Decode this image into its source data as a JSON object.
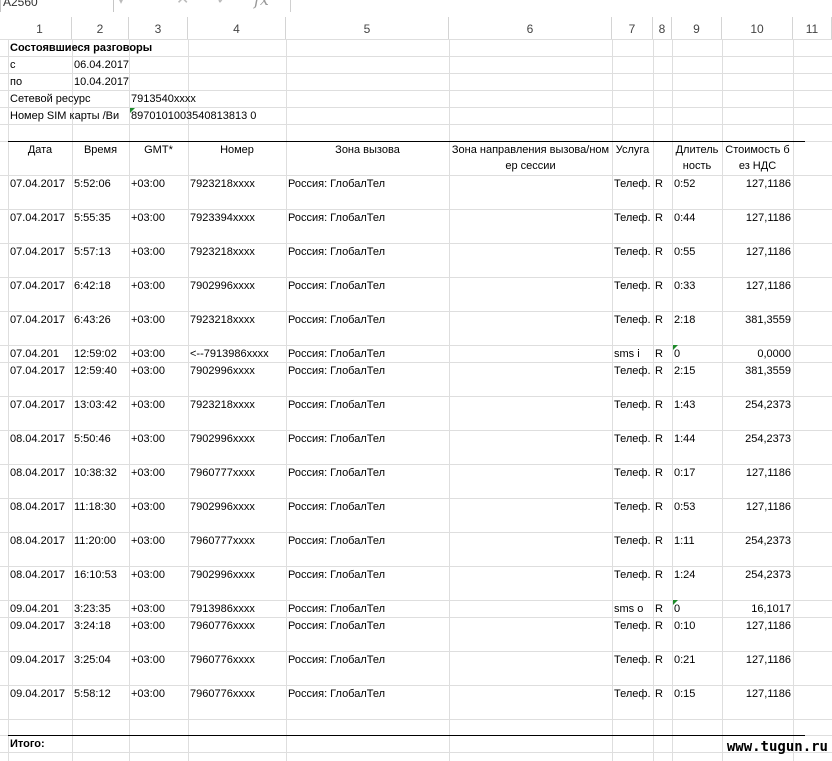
{
  "formula_bar": {
    "name_box": "A2560",
    "fx_symbol": "fx",
    "cancel_symbol": "✕",
    "confirm_symbol": "✓"
  },
  "column_headers": [
    "1",
    "2",
    "3",
    "4",
    "5",
    "6",
    "7",
    "8",
    "9",
    "10",
    "11"
  ],
  "header_block": {
    "title": "Состоявшиеся разговоры",
    "from_label": "с",
    "from_value": "06.04.2017",
    "to_label": "по",
    "to_value": "10.04.2017",
    "resource_label": "Сетевой ресурс",
    "resource_value": "7913540xxxx",
    "sim_label": "Номер SIM карты /Ви",
    "sim_value": "8970101003540813813 0"
  },
  "table": {
    "headers": [
      "Дата",
      "Время",
      "GMT*",
      "Номер",
      "Зона вызова",
      "Зона направления вызова/номер сессии",
      "Услуга",
      "",
      "Длительность",
      "Стоимость без НДС"
    ],
    "rows": [
      {
        "date": "07.04.2017",
        "time": "5:52:06",
        "gmt": "+03:00",
        "number": "7923218xxxx",
        "zone": "Россия: ГлобалТел",
        "service": "Телеф.",
        "r": "R",
        "duration": "0:52",
        "cost": "127,1186"
      },
      {
        "date": "07.04.2017",
        "time": "5:55:35",
        "gmt": "+03:00",
        "number": "7923394xxxx",
        "zone": "Россия: ГлобалТел",
        "service": "Телеф.",
        "r": "R",
        "duration": "0:44",
        "cost": "127,1186"
      },
      {
        "date": "07.04.2017",
        "time": "5:57:13",
        "gmt": "+03:00",
        "number": "7923218xxxx",
        "zone": "Россия: ГлобалТел",
        "service": "Телеф.",
        "r": "R",
        "duration": "0:55",
        "cost": "127,1186"
      },
      {
        "date": "07.04.2017",
        "time": "6:42:18",
        "gmt": "+03:00",
        "number": "7902996xxxx",
        "zone": "Россия: ГлобалТел",
        "service": "Телеф.",
        "r": "R",
        "duration": "0:33",
        "cost": "127,1186"
      },
      {
        "date": "07.04.2017",
        "time": "6:43:26",
        "gmt": "+03:00",
        "number": "7923218xxxx",
        "zone": "Россия: ГлобалТел",
        "service": "Телеф.",
        "r": "R",
        "duration": "2:18",
        "cost": "381,3559"
      },
      {
        "date": "07.04.201",
        "time": "12:59:02",
        "gmt": "+03:00",
        "number": "<--7913986xxxx",
        "zone": "Россия: ГлобалТел",
        "service": "sms i",
        "r": "R",
        "duration": "0",
        "cost": "0,0000"
      },
      {
        "date": "07.04.2017",
        "time": "12:59:40",
        "gmt": "+03:00",
        "number": "7902996xxxx",
        "zone": "Россия: ГлобалТел",
        "service": "Телеф.",
        "r": "R",
        "duration": "2:15",
        "cost": "381,3559"
      },
      {
        "date": "07.04.2017",
        "time": "13:03:42",
        "gmt": "+03:00",
        "number": "7923218xxxx",
        "zone": "Россия: ГлобалТел",
        "service": "Телеф.",
        "r": "R",
        "duration": "1:43",
        "cost": "254,2373"
      },
      {
        "date": "08.04.2017",
        "time": "5:50:46",
        "gmt": "+03:00",
        "number": "7902996xxxx",
        "zone": "Россия: ГлобалТел",
        "service": "Телеф.",
        "r": "R",
        "duration": "1:44",
        "cost": "254,2373"
      },
      {
        "date": "08.04.2017",
        "time": "10:38:32",
        "gmt": "+03:00",
        "number": "7960777xxxx",
        "zone": "Россия: ГлобалТел",
        "service": "Телеф.",
        "r": "R",
        "duration": "0:17",
        "cost": "127,1186"
      },
      {
        "date": "08.04.2017",
        "time": "11:18:30",
        "gmt": "+03:00",
        "number": "7902996xxxx",
        "zone": "Россия: ГлобалТел",
        "service": "Телеф.",
        "r": "R",
        "duration": "0:53",
        "cost": "127,1186"
      },
      {
        "date": "08.04.2017",
        "time": "11:20:00",
        "gmt": "+03:00",
        "number": "7960777xxxx",
        "zone": "Россия: ГлобалТел",
        "service": "Телеф.",
        "r": "R",
        "duration": "1:11",
        "cost": "254,2373"
      },
      {
        "date": "08.04.2017",
        "time": "16:10:53",
        "gmt": "+03:00",
        "number": "7902996xxxx",
        "zone": "Россия: ГлобалТел",
        "service": "Телеф.",
        "r": "R",
        "duration": "1:24",
        "cost": "254,2373"
      },
      {
        "date": "09.04.201",
        "time": "3:23:35",
        "gmt": "+03:00",
        "number": "7913986xxxx",
        "zone": "Россия: ГлобалТел",
        "service": "sms o",
        "r": "R",
        "duration": "0",
        "cost": "16,1017"
      },
      {
        "date": "09.04.2017",
        "time": "3:24:18",
        "gmt": "+03:00",
        "number": "7960776xxxx",
        "zone": "Россия: ГлобалТел",
        "service": "Телеф.",
        "r": "R",
        "duration": "0:10",
        "cost": "127,1186"
      },
      {
        "date": "09.04.2017",
        "time": "3:25:04",
        "gmt": "+03:00",
        "number": "7960776xxxx",
        "zone": "Россия: ГлобалТел",
        "service": "Телеф.",
        "r": "R",
        "duration": "0:21",
        "cost": "127,1186"
      },
      {
        "date": "09.04.2017",
        "time": "5:58:12",
        "gmt": "+03:00",
        "number": "7960776xxxx",
        "zone": "Россия: ГлобалТел",
        "service": "Телеф.",
        "r": "R",
        "duration": "0:15",
        "cost": "127,1186"
      }
    ]
  },
  "total_label": "Итого:",
  "watermark": "www.tugun.ru",
  "colors": {
    "grid": "#dedede",
    "error_triangle": "#1e8a2a"
  }
}
